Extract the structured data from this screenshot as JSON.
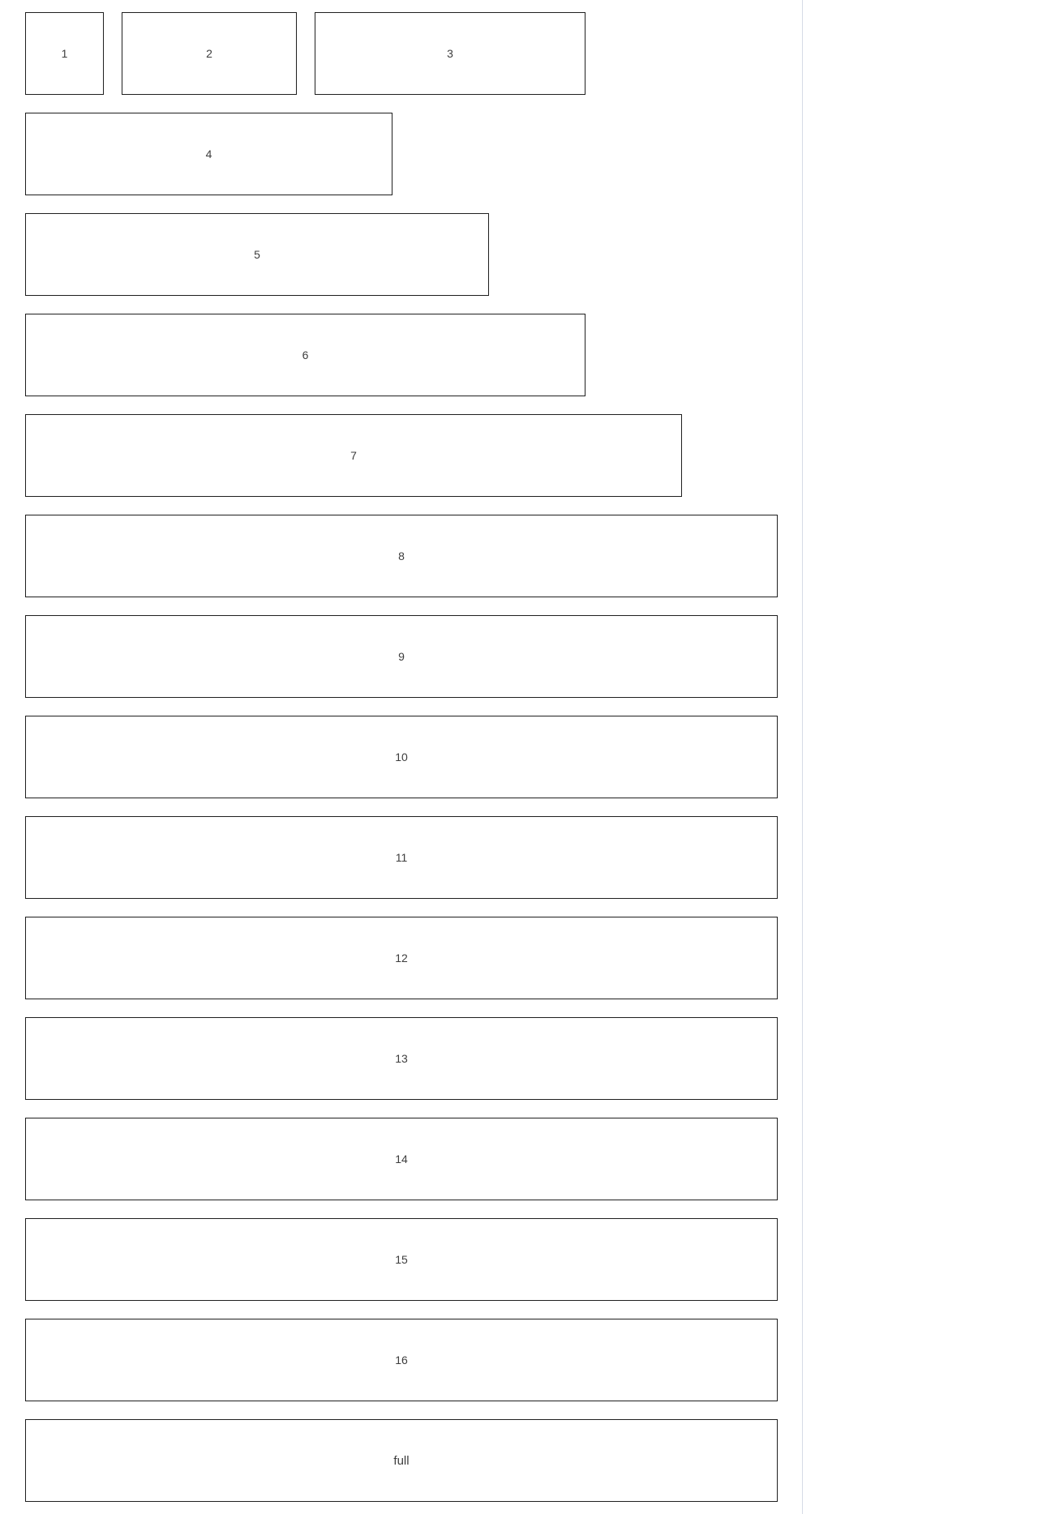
{
  "grid": {
    "boxes": [
      {
        "label": "1"
      },
      {
        "label": "2"
      },
      {
        "label": "3"
      },
      {
        "label": "4"
      },
      {
        "label": "5"
      },
      {
        "label": "6"
      },
      {
        "label": "7"
      },
      {
        "label": "8"
      },
      {
        "label": "9"
      },
      {
        "label": "10"
      },
      {
        "label": "11"
      },
      {
        "label": "12"
      },
      {
        "label": "13"
      },
      {
        "label": "14"
      },
      {
        "label": "15"
      },
      {
        "label": "16"
      },
      {
        "label": "full"
      }
    ]
  },
  "colors": {
    "border": "#1f1f1f",
    "text": "#3d3d3d",
    "divider": "#d6dbe6",
    "background": "#ffffff"
  }
}
